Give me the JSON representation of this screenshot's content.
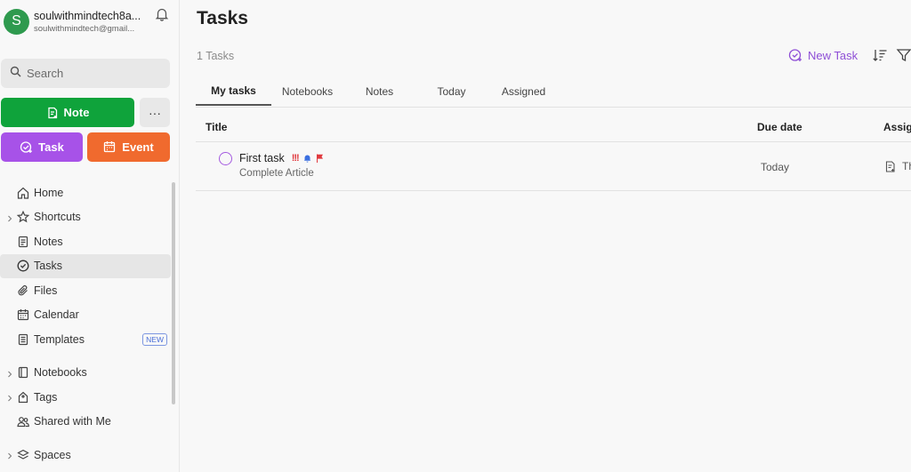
{
  "account": {
    "initial": "S",
    "name": "soulwithmindtech8a...",
    "email": "soulwithmindtech@gmail...",
    "avatar_color": "#2e9a4e"
  },
  "search": {
    "placeholder": "Search"
  },
  "create": {
    "note_label": "Note",
    "more_label": "···",
    "task_label": "Task",
    "event_label": "Event"
  },
  "colors": {
    "note": "#0fa33b",
    "task": "#a752e8",
    "event": "#f06a2e",
    "accent": "#8e4ed6",
    "priority": "#e0393e",
    "reminder": "#3b6fe0"
  },
  "nav": {
    "home": "Home",
    "shortcuts": "Shortcuts",
    "notes": "Notes",
    "tasks": "Tasks",
    "files": "Files",
    "calendar": "Calendar",
    "templates": "Templates",
    "templates_badge": "NEW",
    "notebooks": "Notebooks",
    "tags": "Tags",
    "shared": "Shared with Me",
    "spaces": "Spaces",
    "active": "tasks"
  },
  "main": {
    "title": "Tasks",
    "count": "1 Tasks",
    "new_task_label": "New Task",
    "tabs": [
      {
        "label": "My tasks",
        "active": true
      },
      {
        "label": "Notebooks",
        "active": false
      },
      {
        "label": "Notes",
        "active": false
      },
      {
        "label": "Today",
        "active": false
      },
      {
        "label": "Assigned",
        "active": false
      }
    ],
    "columns": {
      "title": "Title",
      "due": "Due date",
      "assigned": "Assig"
    },
    "tasks": [
      {
        "title": "First task",
        "priority": "!!!",
        "note": "Complete Article",
        "due": "Today",
        "assigned": "Th"
      }
    ]
  }
}
